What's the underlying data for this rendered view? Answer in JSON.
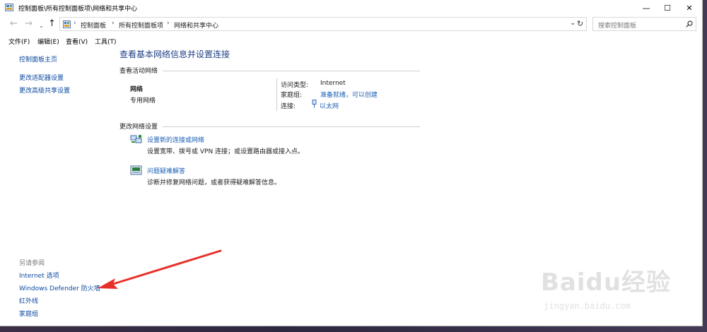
{
  "window": {
    "title": "控制面板\\所有控制面板项\\网络和共享中心",
    "minimize": "—",
    "maximize": "☐",
    "close": "✕"
  },
  "address": {
    "breadcrumbs": [
      "控制面板",
      "所有控制面板项",
      "网络和共享中心"
    ],
    "dropdown": "⌄",
    "refresh": "↻"
  },
  "search": {
    "placeholder": "搜索控制面板",
    "icon": "search-icon"
  },
  "menu": [
    "文件(F)",
    "编辑(E)",
    "查看(V)",
    "工具(T)"
  ],
  "sidebar": {
    "links": [
      "控制面板主页",
      "更改适配器设置",
      "更改高级共享设置"
    ],
    "see_also": {
      "title": "另请参阅",
      "links": [
        "Internet 选项",
        "Windows Defender 防火墙",
        "红外线",
        "家庭组"
      ]
    }
  },
  "main": {
    "heading": "查看基本网络信息并设置连接",
    "active_networks": {
      "title": "查看活动网络",
      "network_name": "网络",
      "network_type": "专用网络",
      "access_type_label": "访问类型:",
      "access_type_value": "Internet",
      "homegroup_label": "家庭组:",
      "homegroup_value": "准备就绪，可以创建",
      "connection_label": "连接:",
      "connection_value": "以太网"
    },
    "change_settings": {
      "title": "更改网络设置",
      "items": [
        {
          "link": "设置新的连接或网络",
          "desc": "设置宽带、拨号或 VPN 连接；或设置路由器或接入点。"
        },
        {
          "link": "问题疑难解答",
          "desc": "诊断并修复网络问题，或者获得疑难解答信息。"
        }
      ]
    }
  },
  "watermark": {
    "brand": "Baidu经验",
    "url": "jingyan.baidu.com"
  },
  "colors": {
    "link": "#1a5fb4",
    "heading": "#1e3f86",
    "arrow": "#e8302a"
  }
}
